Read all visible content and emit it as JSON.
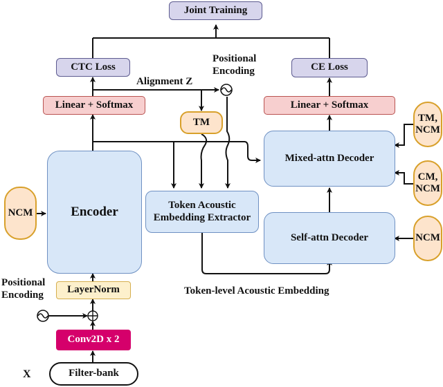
{
  "diagram": {
    "nodes": {
      "joint_training": "Joint Training",
      "ctc_loss": "CTC Loss",
      "ce_loss": "CE Loss",
      "linear_softmax_left": "Linear + Softmax",
      "linear_softmax_right": "Linear + Softmax",
      "tm": "TM",
      "encoder": "Encoder",
      "ncm_encoder": "NCM",
      "token_extractor_line1": "Token Acoustic",
      "token_extractor_line2": "Embedding Extractor",
      "mixed_attn_decoder": "Mixed-attn Decoder",
      "self_attn_decoder": "Self-attn Decoder",
      "tm_ncm_line1": "TM,",
      "tm_ncm_line2": "NCM",
      "cm_ncm_line1": "CM,",
      "cm_ncm_line2": "NCM",
      "ncm_decoder": "NCM",
      "layernorm": "LayerNorm",
      "conv2d": "Conv2D x 2",
      "filterbank": "Filter-bank"
    },
    "labels": {
      "alignment_z": "Alignment Z",
      "pos_enc_top_line1": "Positional",
      "pos_enc_top_line2": "Encoding",
      "pos_enc_bottom_line1": "Positional",
      "pos_enc_bottom_line2": "Encoding",
      "token_level_embedding": "Token-level Acoustic Embedding",
      "input_x": "X"
    },
    "colors": {
      "loss": "#d7d5ec",
      "linear": "#f7cfcf",
      "module": "#d8e7f8",
      "mask": "#fde4cc",
      "layernorm": "#fdf0cc",
      "conv": "#d5006b"
    }
  }
}
